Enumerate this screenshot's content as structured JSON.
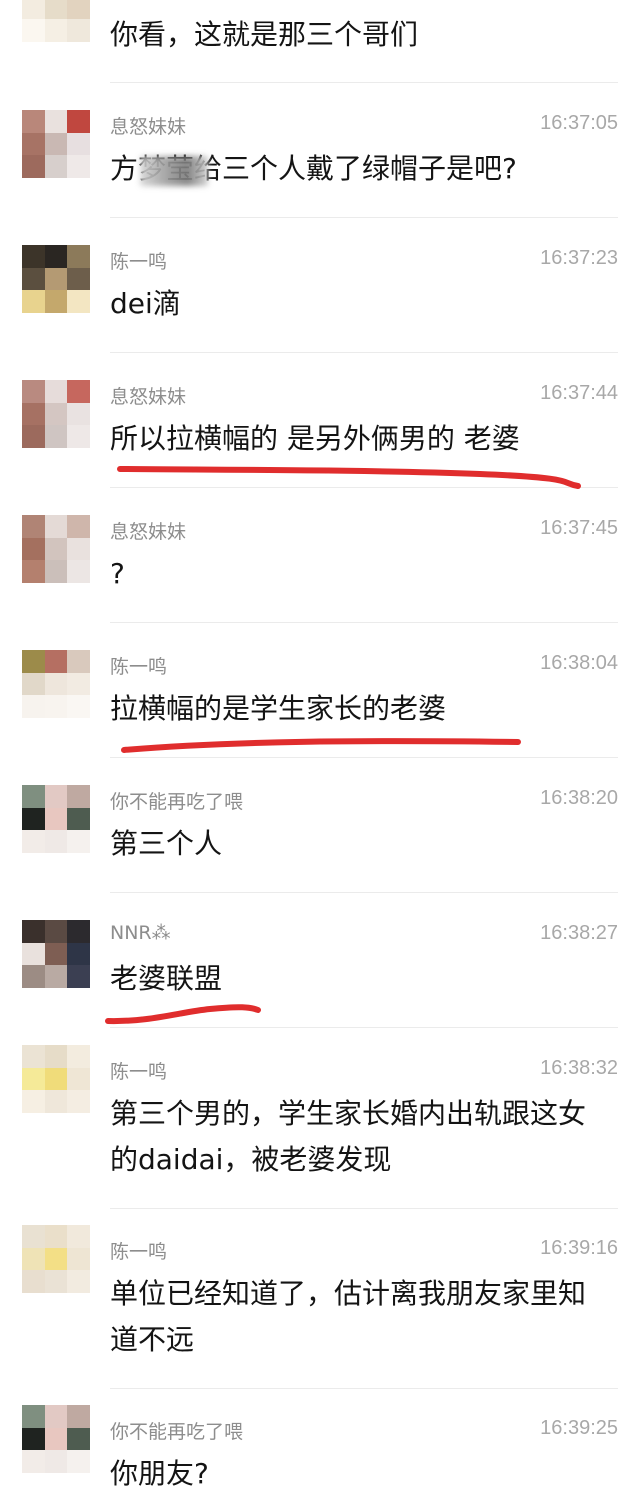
{
  "colors": {
    "underline": "#e02d2d",
    "sender": "#8d8d8d",
    "time": "#a8a8a8",
    "text": "#141414",
    "divider": "#ebebeb"
  },
  "messages": [
    {
      "sender": "",
      "time": "",
      "text": "你看，这就是那三个哥们",
      "avatar": [
        "#efe6d3",
        "#e8dccb",
        "#d9c9b3",
        "#f3ece0",
        "#e6dcc9",
        "#e2d3bf",
        "#fbf7f0",
        "#f5efe4",
        "#efe8dc"
      ]
    },
    {
      "sender": "息怒妹妹",
      "time": "16:37:05",
      "text": "方梦莹给三个人戴了绿帽子是吧?",
      "avatar": [
        "#b9877a",
        "#e9e1de",
        "#c0473f",
        "#a77365",
        "#c9b8b3",
        "#e7dfe0",
        "#9d6a5d",
        "#d7cfcc",
        "#efe9e8"
      ]
    },
    {
      "sender": "陈一鸣",
      "time": "16:37:23",
      "text": "dei滴",
      "avatar": [
        "#3c3429",
        "#2a2622",
        "#8c7a5a",
        "#5b4f3f",
        "#b49a73",
        "#6d5e4b",
        "#e8d38e",
        "#c4a86c",
        "#f3e6c2"
      ]
    },
    {
      "sender": "息怒妹妹",
      "time": "16:37:44",
      "text": "所以拉横幅的 是另外俩男的 老婆",
      "avatar": [
        "#b98a80",
        "#e6dcda",
        "#c6675e",
        "#a67163",
        "#d4c6c2",
        "#e9e2e1",
        "#9c6a5d",
        "#cfc5c2",
        "#eee8e7"
      ]
    },
    {
      "sender": "息怒妹妹",
      "time": "16:37:45",
      "text": "?",
      "avatar": [
        "#b08475",
        "#e4dad6",
        "#cfb6ab",
        "#a4705f",
        "#d2c4be",
        "#e9e1de",
        "#b4806e",
        "#cbbfba",
        "#ece6e4"
      ]
    },
    {
      "sender": "陈一鸣",
      "time": "16:38:04",
      "text": "拉横幅的是学生家长的老婆",
      "avatar": [
        "#9c8b4a",
        "#b56f62",
        "#d9c9bd",
        "#e1d8c9",
        "#eee6dc",
        "#f2ebe2",
        "#f7f3ee",
        "#f8f4ef",
        "#faf7f3"
      ]
    },
    {
      "sender": "你不能再吃了喂",
      "time": "16:38:20",
      "text": "第三个人",
      "avatar": [
        "#7f8f80",
        "#e2c9c4",
        "#bfa9a1",
        "#1f2320",
        "#e8c7c0",
        "#4e5c50",
        "#f2ece8",
        "#efe9e6",
        "#f5f1ee"
      ]
    },
    {
      "sender": "NNR⁂",
      "time": "16:38:27",
      "text": "老婆联盟",
      "avatar": [
        "#3a302c",
        "#5a4a43",
        "#2c2a2e",
        "#e9e1dd",
        "#7e5e53",
        "#2e3547",
        "#9c8c84",
        "#b9aaa3",
        "#3b3f52"
      ]
    },
    {
      "sender": "陈一鸣",
      "time": "16:38:32",
      "text": "第三个男的，学生家长婚内出轨跟这女的daidai，被老婆发现",
      "avatar": [
        "#ebe3d4",
        "#e6dcc8",
        "#f3ecdf",
        "#f5ea98",
        "#f0dc7a",
        "#efe6d5",
        "#f6efe3",
        "#efe7da",
        "#f4ede2"
      ]
    },
    {
      "sender": "陈一鸣",
      "time": "16:39:16",
      "text": "单位已经知道了，估计离我朋友家里知道不远",
      "avatar": [
        "#e9e1d2",
        "#eadfca",
        "#f1e9dc",
        "#efe3b6",
        "#f3df86",
        "#eee5d3",
        "#e8decf",
        "#eae2d5",
        "#f2ebe0"
      ]
    },
    {
      "sender": "你不能再吃了喂",
      "time": "16:39:25",
      "text": "你朋友?",
      "avatar": [
        "#7f8f80",
        "#e2c9c4",
        "#bfa9a1",
        "#1f2320",
        "#e8c7c0",
        "#4e5c50",
        "#f2ece8",
        "#efe9e6",
        "#f5f1ee"
      ]
    }
  ]
}
